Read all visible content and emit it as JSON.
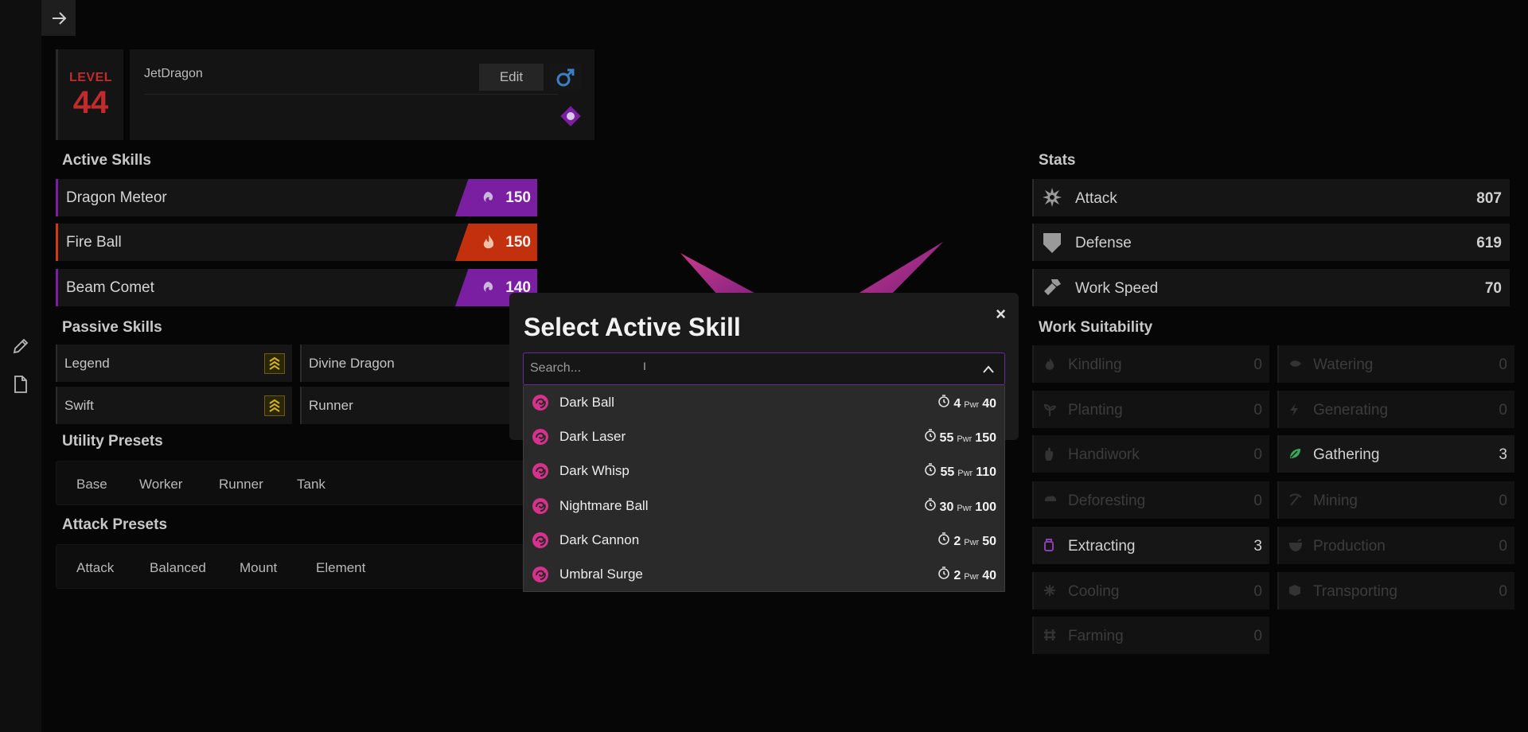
{
  "header": {
    "level_label": "LEVEL",
    "level": "44",
    "name": "JetDragon",
    "edit_label": "Edit"
  },
  "active_skills": {
    "title": "Active Skills",
    "items": [
      {
        "name": "Dragon Meteor",
        "value": "150",
        "element": "dragon",
        "color": "#7b1fa2"
      },
      {
        "name": "Fire Ball",
        "value": "150",
        "element": "fire",
        "color": "#c2300e"
      },
      {
        "name": "Beam Comet",
        "value": "140",
        "element": "dragon",
        "color": "#7b1fa2"
      }
    ]
  },
  "passive_skills": {
    "title": "Passive Skills",
    "items": [
      "Legend",
      "Divine Dragon",
      "Swift",
      "Runner"
    ]
  },
  "utility_presets": {
    "title": "Utility Presets",
    "items": [
      "Base",
      "Worker",
      "Runner",
      "Tank"
    ]
  },
  "attack_presets": {
    "title": "Attack Presets",
    "items": [
      "Attack",
      "Balanced",
      "Mount",
      "Element"
    ]
  },
  "stats": {
    "title": "Stats",
    "items": [
      {
        "label": "Attack",
        "value": "807",
        "icon": "attack-icon"
      },
      {
        "label": "Defense",
        "value": "619",
        "icon": "shield-icon"
      },
      {
        "label": "Work Speed",
        "value": "70",
        "icon": "hammer-icon"
      }
    ]
  },
  "work_suitability": {
    "title": "Work Suitability",
    "items": [
      {
        "label": "Kindling",
        "value": "0",
        "active": false
      },
      {
        "label": "Watering",
        "value": "0",
        "active": false
      },
      {
        "label": "Planting",
        "value": "0",
        "active": false
      },
      {
        "label": "Generating",
        "value": "0",
        "active": false
      },
      {
        "label": "Handiwork",
        "value": "0",
        "active": false
      },
      {
        "label": "Gathering",
        "value": "3",
        "active": true
      },
      {
        "label": "Deforesting",
        "value": "0",
        "active": false
      },
      {
        "label": "Mining",
        "value": "0",
        "active": false
      },
      {
        "label": "Extracting",
        "value": "3",
        "active": true
      },
      {
        "label": "Production",
        "value": "0",
        "active": false
      },
      {
        "label": "Cooling",
        "value": "0",
        "active": false
      },
      {
        "label": "Transporting",
        "value": "0",
        "active": false
      },
      {
        "label": "Farming",
        "value": "0",
        "active": false
      }
    ]
  },
  "modal": {
    "title": "Select Active Skill",
    "close": "×",
    "search_placeholder": "Search...",
    "options": [
      {
        "name": "Dark Ball",
        "ct": "4",
        "pwr_label": "Pwr",
        "pwr": "40"
      },
      {
        "name": "Dark Laser",
        "ct": "55",
        "pwr_label": "Pwr",
        "pwr": "150"
      },
      {
        "name": "Dark Whisp",
        "ct": "55",
        "pwr_label": "Pwr",
        "pwr": "110"
      },
      {
        "name": "Nightmare Ball",
        "ct": "30",
        "pwr_label": "Pwr",
        "pwr": "100"
      },
      {
        "name": "Dark Cannon",
        "ct": "2",
        "pwr_label": "Pwr",
        "pwr": "50"
      },
      {
        "name": "Umbral Surge",
        "ct": "2",
        "pwr_label": "Pwr",
        "pwr": "40"
      }
    ]
  },
  "colors": {
    "accent_dark": "#7b1fa2",
    "accent_fire": "#c2300e",
    "level_red": "#c12b2b",
    "dark_icon": "#d6318c"
  }
}
